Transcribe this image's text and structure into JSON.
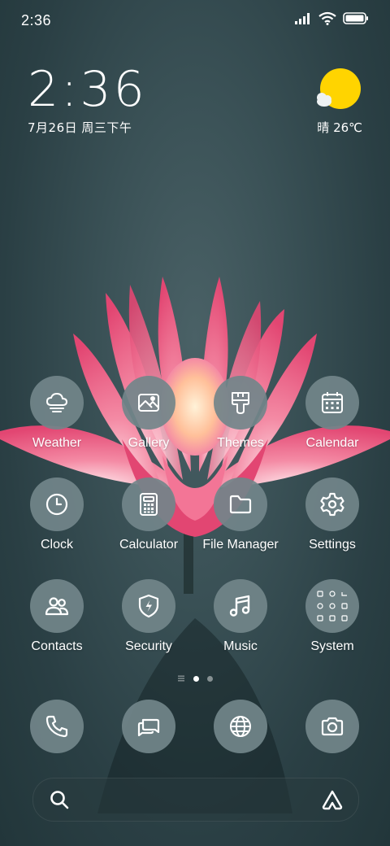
{
  "status_bar": {
    "time": "2:36",
    "icons": [
      "signal-icon",
      "wifi-icon",
      "battery-icon"
    ]
  },
  "clock_widget": {
    "time": "2:36",
    "date": "7月26日 周三下午"
  },
  "weather_widget": {
    "text": "晴 26℃",
    "icon": "sun-cloud-icon"
  },
  "apps": [
    {
      "label": "Weather",
      "icon": "weather-icon"
    },
    {
      "label": "Gallery",
      "icon": "gallery-icon"
    },
    {
      "label": "Themes",
      "icon": "themes-icon"
    },
    {
      "label": "Calendar",
      "icon": "calendar-icon"
    },
    {
      "label": "Clock",
      "icon": "clock-icon"
    },
    {
      "label": "Calculator",
      "icon": "calculator-icon"
    },
    {
      "label": "File Manager",
      "icon": "folder-icon"
    },
    {
      "label": "Settings",
      "icon": "gear-icon"
    },
    {
      "label": "Contacts",
      "icon": "contacts-icon"
    },
    {
      "label": "Security",
      "icon": "shield-icon"
    },
    {
      "label": "Music",
      "icon": "music-icon"
    },
    {
      "label": "System",
      "icon": "folder-grid-icon"
    }
  ],
  "page_indicator": {
    "pages": 2,
    "current": 1
  },
  "dock": [
    {
      "icon": "phone-icon"
    },
    {
      "icon": "messages-icon"
    },
    {
      "icon": "browser-icon"
    },
    {
      "icon": "camera-icon"
    }
  ],
  "search_bar": {
    "left_icon": "search-icon",
    "right_icon": "assistant-icon"
  },
  "colors": {
    "wallpaper": "#33494e",
    "icon_bg": "#72858a",
    "flower": "#e6537a",
    "sun": "#ffd400"
  }
}
